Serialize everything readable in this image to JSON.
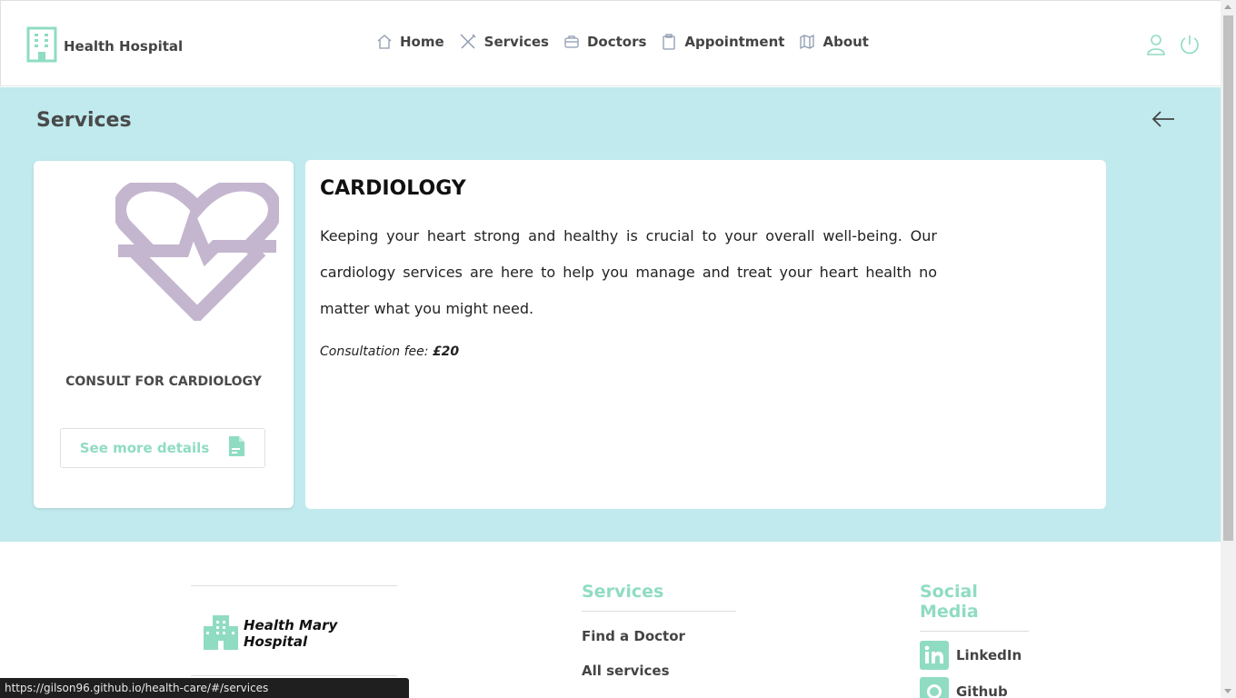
{
  "header": {
    "brand": "Health Hospital",
    "nav": [
      {
        "label": "Home",
        "icon": "home-icon"
      },
      {
        "label": "Services",
        "icon": "tools-icon"
      },
      {
        "label": "Doctors",
        "icon": "briefcase-icon"
      },
      {
        "label": "Appointment",
        "icon": "clipboard-icon"
      },
      {
        "label": "About",
        "icon": "map-icon"
      }
    ],
    "icons": [
      "user-icon",
      "power-icon"
    ]
  },
  "main": {
    "title": "Services",
    "card": {
      "icon": "heartbeat-icon",
      "consult_label": "CONSULT FOR CARDIOLOGY",
      "more_label": "See more details"
    },
    "detail": {
      "title": "CARDIOLOGY",
      "description": "Keeping your heart strong and healthy is crucial to your overall well-being. Our cardiology services are here to help you manage and treat your heart health no matter what you might need.",
      "fee_label": "Consultation fee:",
      "fee_value": "£20"
    }
  },
  "footer": {
    "logo_text": "Health Mary Hospital",
    "services_heading": "Services",
    "services_links": [
      "Find a Doctor",
      "All services"
    ],
    "social_heading": "Social Media",
    "social_links": [
      "LinkedIn",
      "Github"
    ]
  },
  "status_url": "https://gilson96.github.io/health-care/#/services",
  "colors": {
    "accent": "#8fdcc2",
    "main_bg": "#c0eaed",
    "heart": "#c4b6cf"
  }
}
